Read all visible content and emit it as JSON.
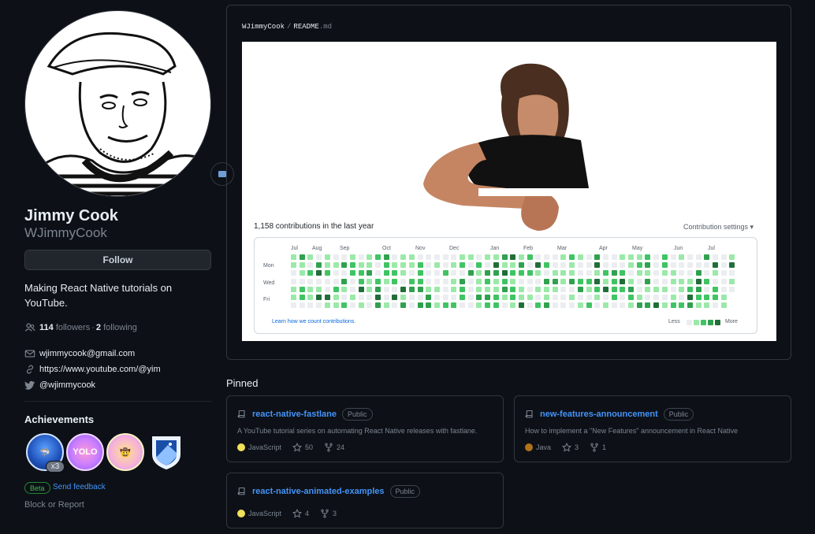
{
  "profile": {
    "name": "Jimmy Cook",
    "login": "WJimmyCook",
    "follow_label": "Follow",
    "bio": "Making React Native tutorials on YouTube.",
    "followers_count": "114",
    "followers_label": "followers",
    "following_count": "2",
    "following_label": "following",
    "email": "wjimmycook@gmail.com",
    "website": "https://www.youtube.com/@yim",
    "twitter": "@wjimmycook"
  },
  "achievements": {
    "title": "Achievements",
    "badge_count": "x3",
    "beta_label": "Beta",
    "feedback_label": "Send feedback"
  },
  "block_label": "Block or Report",
  "readme": {
    "owner": "WJimmyCook",
    "separator": "/",
    "file": "README",
    "ext": ".md",
    "contributions_title": "1,158 contributions in the last year",
    "settings_label": "Contribution settings ▾",
    "months": [
      "Jul",
      "Aug",
      "Sep",
      "Oct",
      "Nov",
      "Dec",
      "Jan",
      "Feb",
      "Mar",
      "Apr",
      "May",
      "Jun",
      "Jul"
    ],
    "days": [
      "Mon",
      "Wed",
      "Fri"
    ],
    "learn_label": "Learn how we count contributions.",
    "less_label": "Less",
    "more_label": "More",
    "level_colors": [
      "#ebedf0",
      "#9be9a8",
      "#40c463",
      "#30a14e",
      "#216e39"
    ]
  },
  "pinned": {
    "title": "Pinned",
    "repos": [
      {
        "name": "react-native-fastlane",
        "visibility": "Public",
        "description": "A YouTube tutorial series on automating React Native releases with fastlane.",
        "language": "JavaScript",
        "language_color": "#f1e05a",
        "stars": "50",
        "forks": "24"
      },
      {
        "name": "new-features-announcement",
        "visibility": "Public",
        "description": "How to implement a \"New Features\" announcement in React Native",
        "language": "Java",
        "language_color": "#b07219",
        "stars": "3",
        "forks": "1"
      },
      {
        "name": "react-native-animated-examples",
        "visibility": "Public",
        "description": "",
        "language": "JavaScript",
        "language_color": "#f1e05a",
        "stars": "4",
        "forks": "3"
      }
    ]
  }
}
